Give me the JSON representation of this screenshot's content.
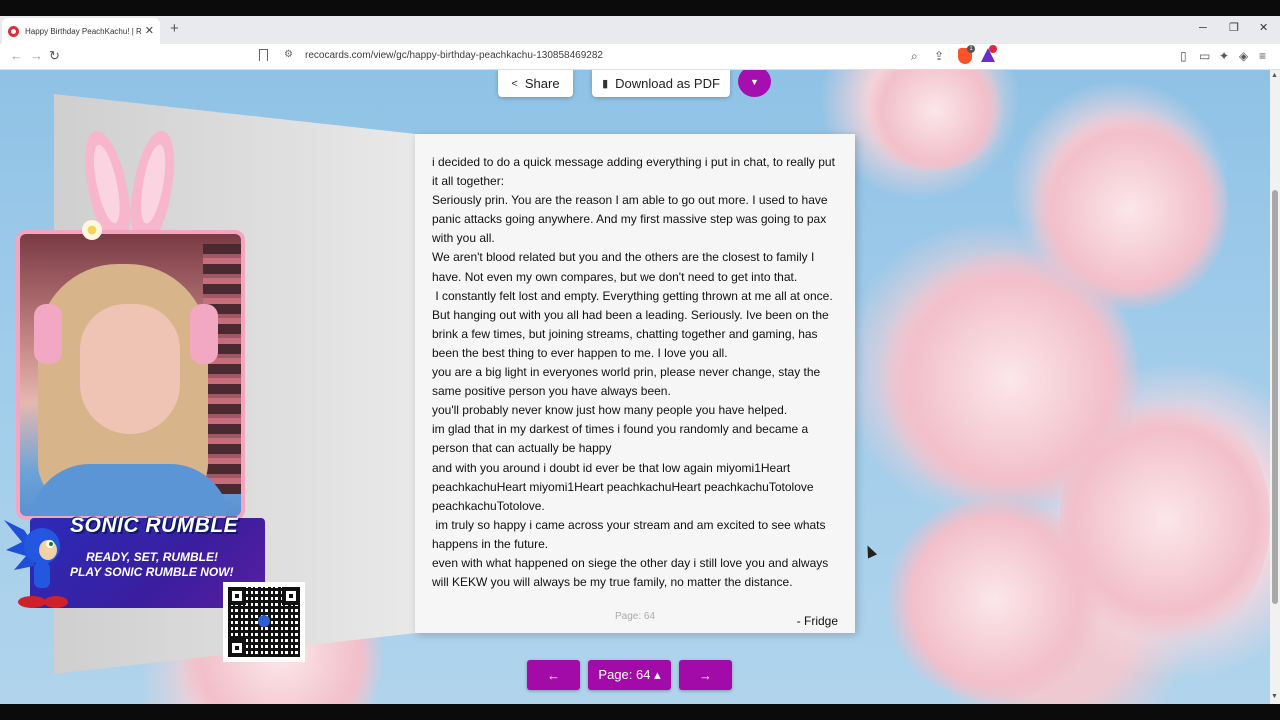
{
  "browser": {
    "tab_title": "Happy Birthday PeachKachu! | R",
    "new_tab": "+",
    "tab_close": "✕",
    "url": "recocards.com/view/gc/happy-birthday-peachkachu-130858469282",
    "window_controls": {
      "minimize": "─",
      "restore": "❐",
      "close": "✕"
    },
    "nav": {
      "back": "←",
      "forward": "→",
      "reload": "↻"
    },
    "right_icons": {
      "zoom": "⌕",
      "share": "⇪",
      "sidebar": "▯",
      "wallet": "▭",
      "leo": "✦",
      "vpn": "◈",
      "menu": "≡"
    },
    "brave_badge": "1"
  },
  "toolbar": {
    "share_label": "Share",
    "pdf_label": "Download as PDF",
    "share_icon": "share-icon",
    "pdf_icon": "file-pdf-icon",
    "caret_icon": "caret-down-icon",
    "accent_color": "#a20ba8"
  },
  "card": {
    "message": [
      "i decided to do a quick message adding everything i put in chat, to really put it all together:",
      "Seriously prin. You are the reason I am able to go out more. I used to have panic attacks going anywhere. And my first massive step was going to pax with you all.",
      "We aren't blood related but you and the others are the closest to family I have. Not even my own compares, but we don't need to get into that.",
      " I constantly felt lost and empty. Everything getting thrown at me all at once. But hanging out with you all had been a leading. Seriously. Ive been on the brink a few times, but joining streams, chatting together and gaming, has been the best thing to ever happen to me. I love you all.",
      "you are a big light in everyones world prin, please never change, stay the same positive person you have always been.",
      "you'll probably never know just how many people you have helped.",
      "im glad that in my darkest of times i found you randomly and became a person that can actually be happy",
      "and with you around i doubt id ever be that low again miyomi1Heart peachkachuHeart miyomi1Heart peachkachuHeart peachkachuTotolove peachkachuTotolove.",
      " im truly so happy i came across your stream and am excited to see whats happens in the future.",
      "even with what happened on siege the other day i still love you and always will KEKW you will always be my true family, no matter the distance."
    ],
    "page_label": "Page: 64",
    "signature": "- Fridge"
  },
  "ad": {
    "title": "SONIC RUMBLE",
    "line1": "READY, SET, RUMBLE!",
    "line2": "PLAY SONIC RUMBLE NOW!"
  },
  "pager": {
    "prev": "←",
    "page": "Page: 64 ▴",
    "next": "→"
  }
}
